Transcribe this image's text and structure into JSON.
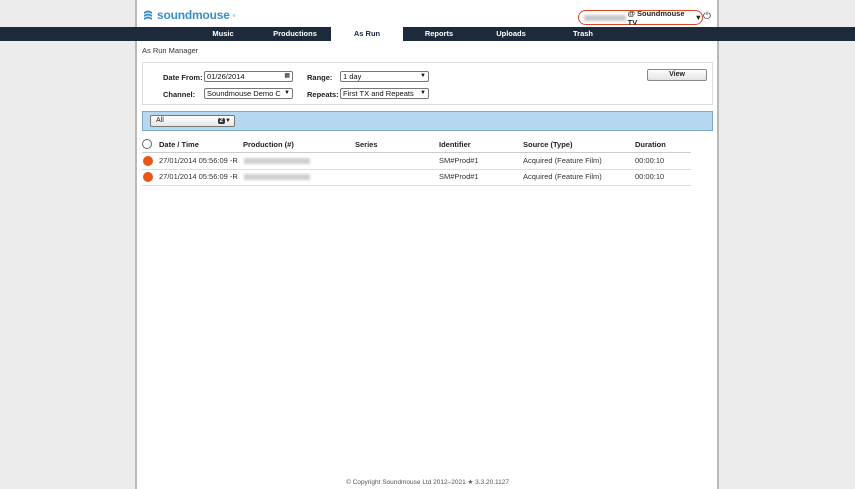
{
  "header": {
    "logo_text": "soundmouse",
    "logo_tm": "®",
    "user_name": "Mayer Yllana",
    "user_org": "@ Soundmouse TV",
    "user_caret": "▼",
    "power_glyph": "⏻"
  },
  "nav": {
    "tabs": [
      {
        "label": "Music",
        "active": false
      },
      {
        "label": "Productions",
        "active": false
      },
      {
        "label": "As Run",
        "active": true
      },
      {
        "label": "Reports",
        "active": false
      },
      {
        "label": "Uploads",
        "active": false
      },
      {
        "label": "Trash",
        "active": false
      }
    ]
  },
  "breadcrumb": "As Run Manager",
  "filters": {
    "date_from_label": "Date From:",
    "date_from_value": "01/26/2014",
    "range_label": "Range:",
    "range_value": "1 day",
    "channel_label": "Channel:",
    "channel_value": "Soundmouse Demo C",
    "repeats_label": "Repeats:",
    "repeats_value": "First TX and Repeats",
    "view_button": "View"
  },
  "filterbar": {
    "all_label": "All",
    "all_count": "2",
    "all_caret": "▼"
  },
  "table": {
    "columns": [
      "Date / Time",
      "Production (#)",
      "Series",
      "Identifier",
      "Source (Type)",
      "Duration"
    ],
    "rows": [
      {
        "datetime": "27/01/2014 05:56:09 -R",
        "production": "Jamie's Fish Supper",
        "series": "",
        "identifier": "SM#Prod#1",
        "source": "Acquired (Feature Film)",
        "duration": "00:00:10"
      },
      {
        "datetime": "27/01/2014 05:56:09 -R",
        "production": "Jamie's Fish Supper",
        "series": "",
        "identifier": "SM#Prod#1",
        "source": "Acquired (Feature Film)",
        "duration": "00:00:10"
      }
    ]
  },
  "footer": "© Copyright Soundmouse Ltd 2012–2021 ★ 3.3.20.1127",
  "colors": {
    "nav_bg": "#1d2a3b",
    "brand_blue": "#3b8fc9",
    "status_dot": "#e8561a",
    "filterbar_bg": "#b6d7f0",
    "user_highlight": "#d9472b"
  },
  "icons": {
    "power": "power-icon",
    "logo": "soundmouse-logo-icon",
    "status": "status-dot-icon"
  }
}
